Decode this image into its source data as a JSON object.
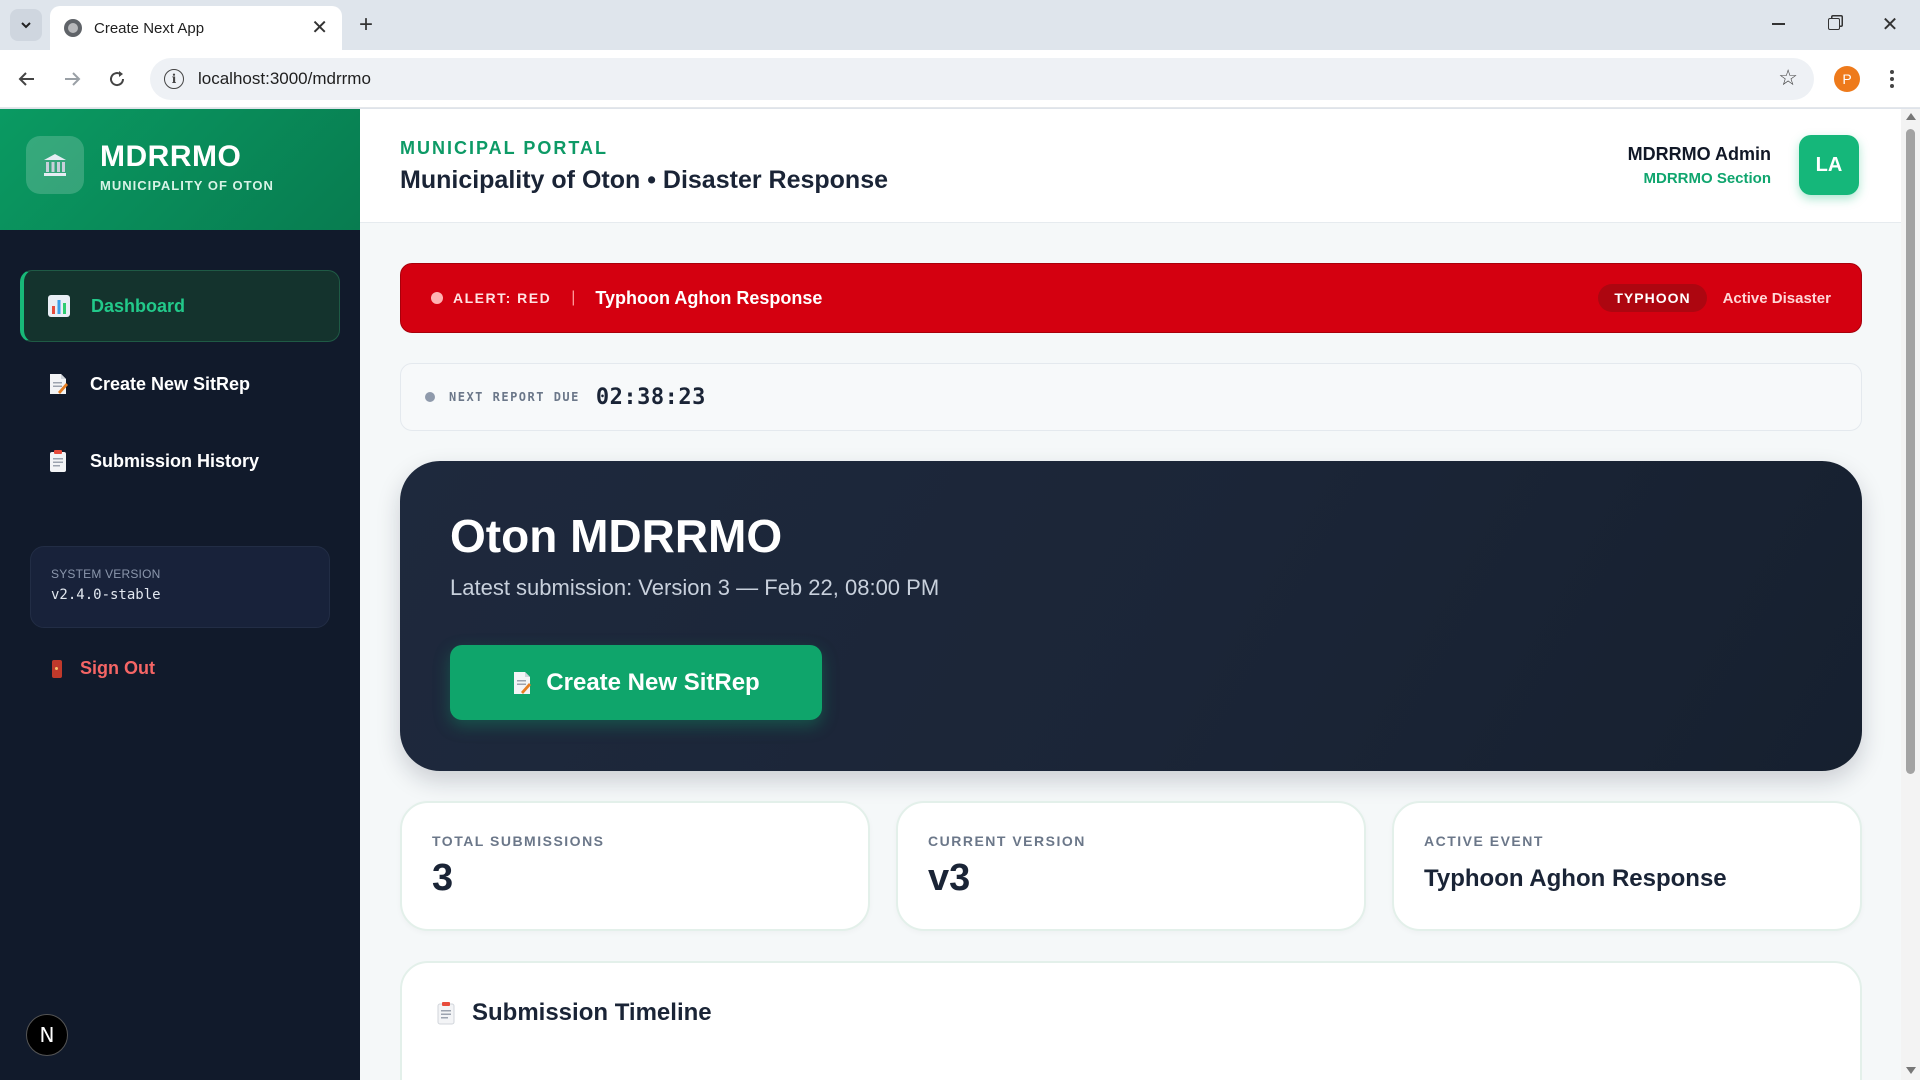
{
  "browser": {
    "tab_title": "Create Next App",
    "url": "localhost:3000/mdrrmo",
    "profile_initial": "P"
  },
  "sidebar": {
    "brand_name": "MDRRMO",
    "brand_sub": "MUNICIPALITY OF OTON",
    "items": [
      {
        "label": "Dashboard",
        "icon": "bar-chart-icon",
        "active": true
      },
      {
        "label": "Create New SitRep",
        "icon": "document-icon",
        "active": false
      },
      {
        "label": "Submission History",
        "icon": "clipboard-icon",
        "active": false
      }
    ],
    "version_label": "SYSTEM VERSION",
    "version_value": "v2.4.0-stable",
    "sign_out": "Sign Out",
    "next_badge": "N"
  },
  "header": {
    "portal_label": "MUNICIPAL PORTAL",
    "portal_title": "Municipality of Oton • Disaster Response",
    "user_name": "MDRRMO Admin",
    "user_section": "MDRRMO Section",
    "avatar_initials": "LA"
  },
  "alert": {
    "level": "ALERT: RED",
    "separator": "|",
    "event_name": "Typhoon Aghon Response",
    "type_badge": "TYPHOON",
    "status": "Active Disaster"
  },
  "timer": {
    "label": "NEXT REPORT DUE",
    "value": "02:38:23"
  },
  "hero": {
    "title": "Oton MDRRMO",
    "subtitle": "Latest submission: Version 3 — Feb 22, 08:00 PM",
    "button_label": "Create New SitRep"
  },
  "stats": [
    {
      "label": "TOTAL SUBMISSIONS",
      "value": "3"
    },
    {
      "label": "CURRENT VERSION",
      "value": "v3"
    },
    {
      "label": "ACTIVE EVENT",
      "value": "Typhoon Aghon Response"
    }
  ],
  "timeline": {
    "title": "Submission Timeline"
  },
  "colors": {
    "brand_green": "#0a9a62",
    "sidebar_bg": "#111a2b",
    "alert_red": "#d40010",
    "hero_dark": "#1b2537"
  }
}
